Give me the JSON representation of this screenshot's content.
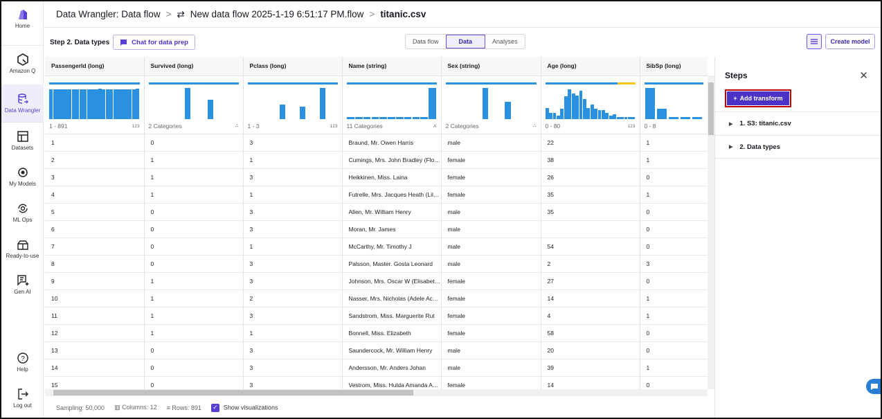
{
  "colors": {
    "accent": "#5a3fd6",
    "bar": "#2a91e0",
    "missing": "#f5c518",
    "highlight": "#c00000"
  },
  "sidebar": {
    "items": [
      {
        "label": "Home",
        "icon": "home-logo-icon"
      },
      {
        "label": "Amazon Q",
        "icon": "amazon-q-icon"
      },
      {
        "label": "Data Wrangler",
        "icon": "data-wrangler-icon",
        "active": true
      },
      {
        "label": "Datasets",
        "icon": "datasets-icon"
      },
      {
        "label": "My Models",
        "icon": "models-icon"
      },
      {
        "label": "ML Ops",
        "icon": "ml-ops-icon"
      },
      {
        "label": "Ready-to-use",
        "icon": "ready-to-use-icon"
      },
      {
        "label": "Gen AI",
        "icon": "gen-ai-icon"
      },
      {
        "label": "Help",
        "icon": "help-icon"
      },
      {
        "label": "Log out",
        "icon": "logout-icon"
      }
    ]
  },
  "header": {
    "crumb1": "Data Wrangler: Data flow",
    "crumb2": "New data flow 2025-1-19 6:51:17 PM.flow",
    "crumb3": "titanic.csv"
  },
  "toolbar": {
    "step_title": "Step 2. Data types",
    "chat_label": "Chat for data prep",
    "tabs": [
      "Data flow",
      "Data",
      "Analyses"
    ],
    "active_tab": "Data",
    "create_model": "Create model"
  },
  "table": {
    "columns": [
      {
        "header": "PassengerId (long)",
        "range": "1 - 891",
        "type": "123",
        "bars": [
          0.95,
          0.95,
          0.95,
          0.95,
          0.95,
          0.95,
          0.95,
          0.95,
          0.95,
          0.95,
          0.95,
          0.95,
          0.95,
          0.97,
          0.95,
          0.95,
          0.95,
          0.95,
          0.95,
          0.95,
          0.95,
          0.95,
          0.95,
          0.97
        ],
        "gap": 0.05
      },
      {
        "header": "Survived (long)",
        "range": "2 Categories",
        "type": "cat",
        "bars": [
          0,
          0,
          0,
          1,
          0,
          0.62,
          0,
          0
        ],
        "gap": 0.5
      },
      {
        "header": "Pclass (long)",
        "range": "1 - 3",
        "type": "123",
        "bars": [
          0,
          0,
          0,
          0.45,
          0,
          0.38,
          0,
          1,
          0
        ],
        "gap": 0.45
      },
      {
        "header": "Name (string)",
        "range": "11 Categories",
        "type": "A",
        "bars": [
          0.05,
          0.05,
          0.05,
          0.05,
          0.05,
          0.05,
          0.05,
          0.05,
          0.05,
          0.05,
          1
        ],
        "gap": 0.1
      },
      {
        "header": "Sex (string)",
        "range": "2 Categories",
        "type": "cat",
        "bars": [
          0,
          0,
          0,
          1,
          0,
          0.55,
          0,
          0
        ],
        "gap": 0.5
      },
      {
        "header": "Age (long)",
        "range": "0 - 80",
        "type": "123",
        "missing": 0.2,
        "bars": [
          0.35,
          0.2,
          0.18,
          0.1,
          0.32,
          0.72,
          0.95,
          0.82,
          0.75,
          0.9,
          0.63,
          0.35,
          0.45,
          0.32,
          0.28,
          0.28,
          0.2,
          0.1,
          0.15,
          0.05,
          0.05,
          0.05,
          0.05,
          0.05
        ],
        "gap": 0.12
      },
      {
        "header": "SibSp (long)",
        "range": "0 - 8",
        "type": "",
        "bars": [
          1,
          0.33,
          0.05,
          0.05,
          0.05
        ],
        "gap": 0.15
      }
    ],
    "rows": [
      [
        "1",
        "0",
        "3",
        "Braund, Mr. Owen Harris",
        "male",
        "22",
        "1"
      ],
      [
        "2",
        "1",
        "1",
        "Cumings, Mrs. John Bradley (Florence Briggs Thayer)",
        "female",
        "38",
        "1"
      ],
      [
        "3",
        "1",
        "3",
        "Heikkinen, Miss. Laina",
        "female",
        "26",
        "0"
      ],
      [
        "4",
        "1",
        "1",
        "Futrelle, Mrs. Jacques Heath (Lily May Peel)",
        "female",
        "35",
        "1"
      ],
      [
        "5",
        "0",
        "3",
        "Allen, Mr. William Henry",
        "male",
        "35",
        "0"
      ],
      [
        "6",
        "0",
        "3",
        "Moran, Mr. James",
        "male",
        "",
        "0"
      ],
      [
        "7",
        "0",
        "1",
        "McCarthy, Mr. Timothy J",
        "male",
        "54",
        "0"
      ],
      [
        "8",
        "0",
        "3",
        "Palsson, Master. Gosta Leonard",
        "male",
        "2",
        "3"
      ],
      [
        "9",
        "1",
        "3",
        "Johnson, Mrs. Oscar W (Elisabeth Vilhelmina Berg)",
        "female",
        "27",
        "0"
      ],
      [
        "10",
        "1",
        "2",
        "Nasser, Mrs. Nicholas (Adele Achem)",
        "female",
        "14",
        "1"
      ],
      [
        "11",
        "1",
        "3",
        "Sandstrom, Miss. Marguerite Rut",
        "female",
        "4",
        "1"
      ],
      [
        "12",
        "1",
        "1",
        "Bonnell, Miss. Elizabeth",
        "female",
        "58",
        "0"
      ],
      [
        "13",
        "0",
        "3",
        "Saundercock, Mr. William Henry",
        "male",
        "20",
        "0"
      ],
      [
        "14",
        "0",
        "3",
        "Andersson, Mr. Anders Johan",
        "male",
        "39",
        "1"
      ],
      [
        "15",
        "0",
        "3",
        "Vestrom, Miss. Hulda Amanda Adolfina",
        "female",
        "14",
        "0"
      ]
    ]
  },
  "footer": {
    "sampling": "Sampling: 50,000",
    "columns": "Columns: 12",
    "rows": "Rows: 891",
    "show_viz": "Show visualizations",
    "show_viz_checked": true
  },
  "panel": {
    "title": "Steps",
    "add_transform": "Add transform",
    "steps": [
      "1. S3: titanic.csv",
      "2. Data types"
    ]
  }
}
